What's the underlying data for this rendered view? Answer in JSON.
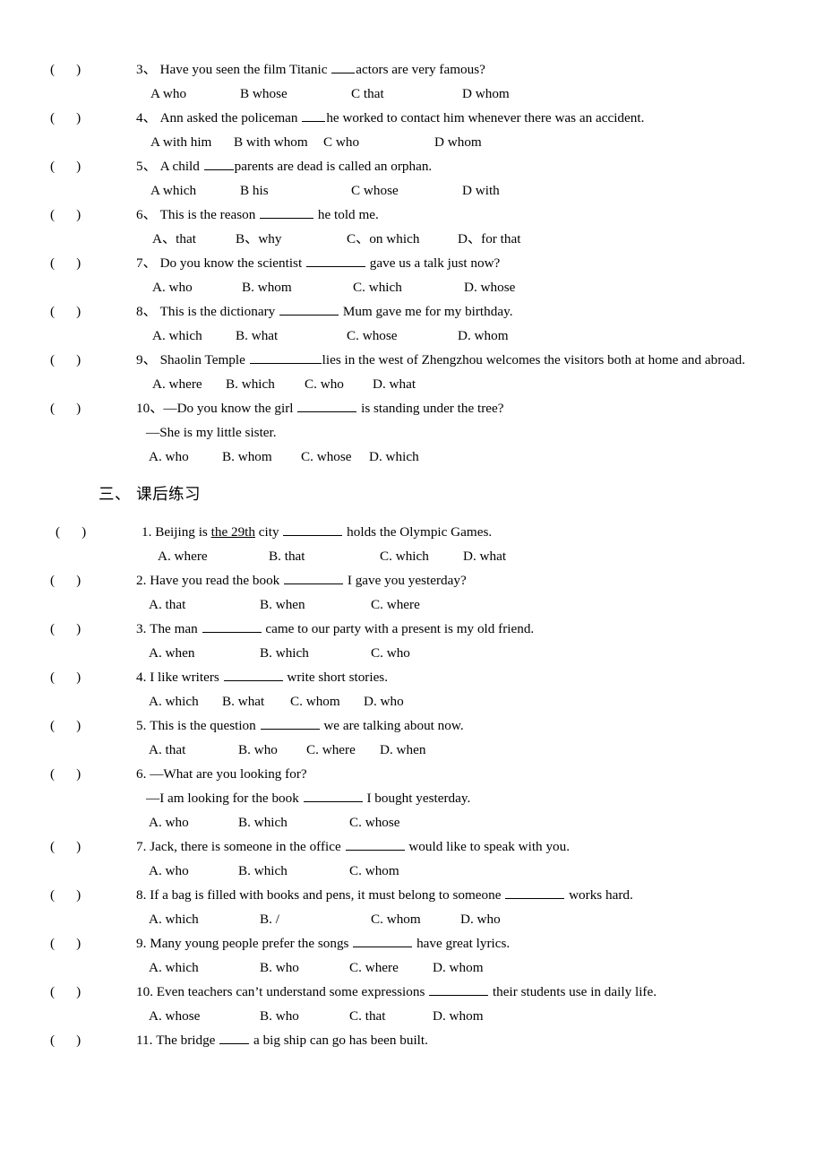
{
  "document": {
    "type": "english-grammar-worksheet",
    "language_mix": [
      "en",
      "zh"
    ],
    "paper_color": "#ffffff",
    "text_color": "#000000"
  },
  "section_two_continued": {
    "items": [
      {
        "bracket": "(",
        "close": ")",
        "number": "3、",
        "stem_before": "Have you seen the film Titanic ",
        "blank": "___",
        "stem_after": "actors are very famous?",
        "options": [
          "A who",
          "B whose",
          "C that",
          "D whom"
        ]
      },
      {
        "bracket": "(",
        "close": ")",
        "number": "4、",
        "stem_before": "Ann asked the policeman ",
        "blank": "___",
        "stem_after": "he worked to contact him whenever there was an accident.",
        "options": [
          "A with him",
          "B with whom",
          "C who",
          "D whom"
        ]
      },
      {
        "bracket": "(",
        "close": ")",
        "number": "5、",
        "stem_before": "A child ",
        "blank": "____",
        "stem_after": "parents are dead is called an orphan.",
        "options": [
          "A which",
          "B his",
          "C whose",
          "D with"
        ]
      },
      {
        "bracket": "(",
        "close": ")",
        "number": "6、",
        "stem_before": "This is the reason ",
        "blank": "______",
        "stem_after": " he told me.",
        "options": [
          "A、that",
          "B、why",
          "C、on which",
          "D、for that"
        ]
      },
      {
        "bracket": "(",
        "close": ")",
        "number": "7、",
        "stem_before": "Do you know the scientist ",
        "blank": "_______",
        "stem_after": " gave us a talk just now?",
        "options": [
          "A. who",
          "B. whom",
          "C. which",
          "D. whose"
        ]
      },
      {
        "bracket": "(",
        "close": ")",
        "number": "8、",
        "stem_before": "This is the dictionary ",
        "blank": "_______",
        "stem_after": " Mum gave me for my birthday.",
        "options": [
          "A. which",
          "B. what",
          "C. whose",
          "D. whom"
        ]
      },
      {
        "bracket": "(",
        "close": ")",
        "number": "9、",
        "stem_before": "Shaolin Temple ",
        "blank": "__________",
        "stem_after": "lies in the west of Zhengzhou welcomes the visitors both at home and abroad.",
        "options": [
          "A. where",
          "B. which",
          "C. who",
          "D. what"
        ]
      },
      {
        "bracket": "(",
        "close": ")",
        "number": "10、",
        "stem_before": "—Do you know the girl ",
        "blank": "_______",
        "stem_after": " is standing under the tree?",
        "reply": "—She is my little sister.",
        "options": [
          "A. who",
          "B. whom",
          "C. whose",
          "D. which"
        ]
      }
    ]
  },
  "section_three": {
    "heading": "三、 课后练习",
    "items": [
      {
        "bracket": "(",
        "close": ")",
        "number": "1.",
        "stem_before": "Beijing is ",
        "underlined": "the 29th",
        "stem_mid": " city ",
        "blank": "_______",
        "stem_after": " holds the Olympic Games.",
        "options": [
          "A. where",
          "B. that",
          "C. which",
          "D. what"
        ]
      },
      {
        "bracket": "(",
        "close": ")",
        "number": "2.",
        "stem_before": "Have you read the book ",
        "blank": "_______",
        "stem_after": " I gave you yesterday?",
        "options": [
          "A. that",
          "B. when",
          "C. where"
        ]
      },
      {
        "bracket": "(",
        "close": ")",
        "number": "3.",
        "stem_before": "The man ",
        "blank": "_______",
        "stem_after": " came to our party with a present is my old friend.",
        "options": [
          "A. when",
          "B. which",
          "C. who"
        ]
      },
      {
        "bracket": "(",
        "close": ")",
        "number": "4.",
        "stem_before": "I like writers ",
        "blank": "_______",
        "stem_after": " write short stories.",
        "options": [
          "A. which",
          "B. what",
          "C. whom",
          "D. who"
        ]
      },
      {
        "bracket": "(",
        "close": ")",
        "number": "5.",
        "stem_before": "This is the question ",
        "blank": "_______",
        "stem_after": " we are talking about now.",
        "options": [
          "A. that",
          "B. who",
          "C. where",
          "D. when"
        ]
      },
      {
        "bracket": "(",
        "close": ")",
        "number": "6.",
        "stem_before": "—What are you looking for?",
        "blank": "",
        "stem_after": "",
        "reply_before": "—I am looking for the book ",
        "reply_blank": "_______",
        "reply_after": " I bought yesterday.",
        "options": [
          "A. who",
          "B. which",
          "C. whose"
        ]
      },
      {
        "bracket": "(",
        "close": ")",
        "number": "7.",
        "stem_before": "Jack, there is someone in the office ",
        "blank": "_______",
        "stem_after": " would like to speak with you.",
        "options": [
          "A. who",
          "B. which",
          "C. whom"
        ]
      },
      {
        "bracket": "(",
        "close": ")",
        "number": "8.",
        "stem_before": "If a bag is filled with books and pens, it must belong to someone ",
        "blank": "_______",
        "stem_after": " works hard.",
        "options": [
          "A. which",
          "B. /",
          "C. whom",
          "D. who"
        ]
      },
      {
        "bracket": "(",
        "close": ")",
        "number": "9.",
        "stem_before": "Many young people prefer the songs ",
        "blank": "_______",
        "stem_after": " have great lyrics.",
        "options": [
          "A. which",
          "B. who",
          "C. where",
          "D. whom"
        ]
      },
      {
        "bracket": "(",
        "close": ")",
        "number": "10.",
        "stem_before": "Even teachers can’t understand some expressions ",
        "blank": "_______",
        "stem_after": " their students use in daily life.",
        "options": [
          "A. whose",
          "B. who",
          "C. that",
          "D. whom"
        ]
      },
      {
        "bracket": "(",
        "close": ")",
        "number": "11.",
        "stem_before": "The bridge ",
        "blank": "____",
        "stem_after": " a big ship can go has been built.",
        "options": []
      }
    ]
  }
}
